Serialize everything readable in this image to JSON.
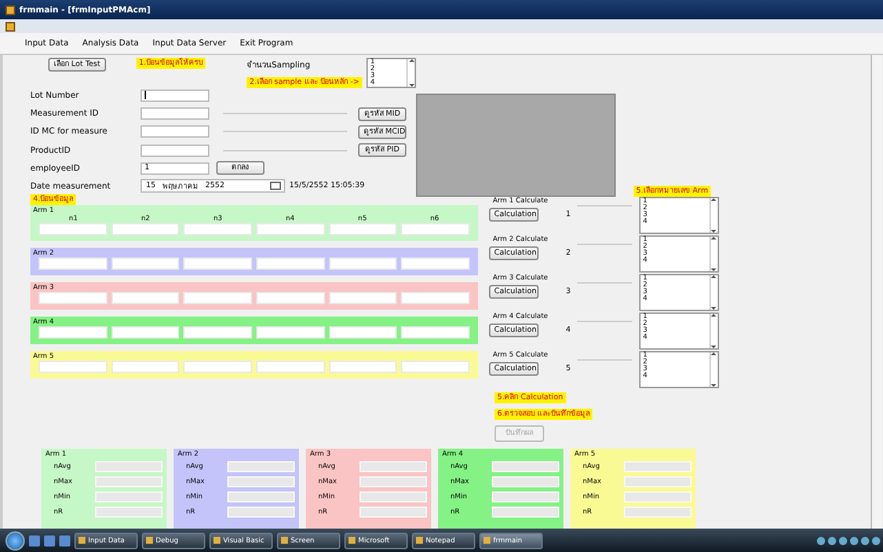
{
  "window": {
    "title": "frmmain - [frmInputPMAcm]"
  },
  "menu": [
    {
      "label": "Input Data"
    },
    {
      "label": "Analysis Data"
    },
    {
      "label": "Input Data Server"
    },
    {
      "label": "Exit Program"
    }
  ],
  "form": {
    "lot_button": "เลือก Lot Test",
    "step1_note": "1.ป้อนข้อมูลให้ครบ",
    "sampling_label": "จำนวนSampling",
    "step2_note": "2.เลือก sample และ ป้อนหลัก ->",
    "sampling_list": [
      "1",
      "2",
      "3",
      "4"
    ],
    "fields": [
      {
        "label": "Lot Number",
        "focused": true
      },
      {
        "label": "Measurement ID",
        "focused": false,
        "lookup": "ดูรหัส MID"
      },
      {
        "label": "ID MC for measure",
        "focused": false,
        "lookup": "ดูรหัส MCID"
      },
      {
        "label": "ProductID",
        "focused": false,
        "lookup": "ดูรหัส PID"
      },
      {
        "label": "employeeID",
        "value": "1",
        "focused": false,
        "action": "ตกลง"
      }
    ],
    "date": {
      "label": "Date measurement",
      "day": "15",
      "month": "พฤษภาคม",
      "year": "2552",
      "timestamp": "15/5/2552 15:05:39"
    },
    "step4_note": "4.ป้อนข้อมูล",
    "columns": [
      "n1",
      "n2",
      "n3",
      "n4",
      "n5",
      "n6"
    ],
    "step5_note": "5.เลือกหมายเลข Arm",
    "arms": [
      {
        "name": "Arm 1",
        "color": "#c6f7c6",
        "calc_label": "Arm 1 Calculate",
        "calc_button": "Calculation",
        "result": "1",
        "choices": [
          "1",
          "2",
          "3",
          "4"
        ]
      },
      {
        "name": "Arm 2",
        "color": "#c4c4fa",
        "calc_label": "Arm 2 Calculate",
        "calc_button": "Calculation",
        "result": "2",
        "choices": [
          "1",
          "2",
          "3",
          "4"
        ]
      },
      {
        "name": "Arm 3",
        "color": "#fac4c4",
        "calc_label": "Arm 3 Calculate",
        "calc_button": "Calculation",
        "result": "3",
        "choices": [
          "1",
          "2",
          "3",
          "4"
        ]
      },
      {
        "name": "Arm 4",
        "color": "#84f284",
        "calc_label": "Arm 4 Calculate",
        "calc_button": "Calculation",
        "result": "4",
        "choices": [
          "1",
          "2",
          "3",
          "4"
        ]
      },
      {
        "name": "Arm 5",
        "color": "#fafa94",
        "calc_label": "Arm 5 Calculate",
        "calc_button": "Calculation",
        "result": "5",
        "choices": [
          "1",
          "2",
          "3",
          "4"
        ]
      }
    ],
    "calc_note": "5.คลิก Calculation",
    "save_note": "6.ตรวจสอบ และบันทึกข้อมูล",
    "save_button": {
      "label": "บันทึกผล",
      "disabled": true
    },
    "summary": [
      {
        "name": "Arm 1",
        "color": "#c6f7c6",
        "stats": [
          "nAvg",
          "nMax",
          "nMin",
          "nR"
        ]
      },
      {
        "name": "Arm 2",
        "color": "#c4c4fa",
        "stats": [
          "nAvg",
          "nMax",
          "nMin",
          "nR"
        ]
      },
      {
        "name": "Arm 3",
        "color": "#fac4c4",
        "stats": [
          "nAvg",
          "nMax",
          "nMin",
          "nR"
        ]
      },
      {
        "name": "Arm 4",
        "color": "#84f284",
        "stats": [
          "nAvg",
          "nMax",
          "nMin",
          "nR"
        ]
      },
      {
        "name": "Arm 5",
        "color": "#fafa94",
        "stats": [
          "nAvg",
          "nMax",
          "nMin",
          "nR"
        ]
      }
    ]
  },
  "taskbar": [
    {
      "label": "Input Data",
      "active": false
    },
    {
      "label": "Debug",
      "active": false
    },
    {
      "label": "Visual Basic",
      "active": false
    },
    {
      "label": "Screen",
      "active": false
    },
    {
      "label": "Microsoft",
      "active": false
    },
    {
      "label": "Notepad",
      "active": false
    },
    {
      "label": "frmmain",
      "active": true
    }
  ]
}
